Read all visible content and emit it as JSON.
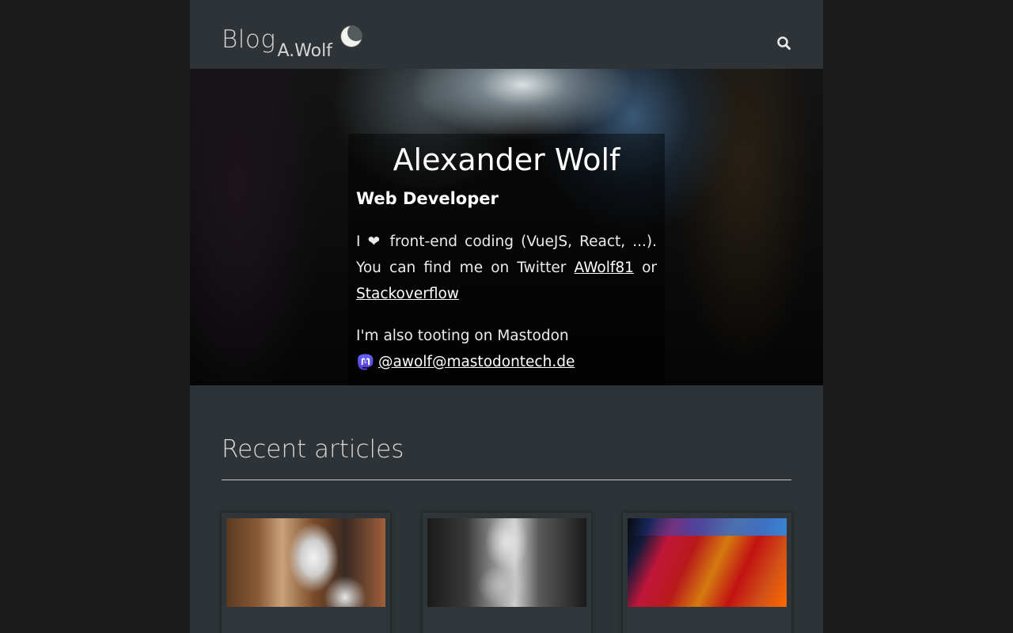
{
  "header": {
    "logo_blog": "Blog",
    "logo_name": "A.Wolf",
    "theme_toggle_icon": "moon-icon",
    "search_icon": "search-icon"
  },
  "hero": {
    "name": "Alexander Wolf",
    "role": "Web Developer",
    "bio_prefix": "I",
    "bio_heart": "❤",
    "bio_middle": " front-end coding (VueJS, React, ...). You can find me on Twitter ",
    "twitter_label": "AWolf81",
    "bio_or": " or ",
    "stackoverflow_label": "Stackoverflow",
    "mastodon_intro": "I'm also tooting on Mastodon",
    "mastodon_handle": "@awolf@mastodontech.de",
    "mastodon_icon": "mastodon-icon"
  },
  "recent": {
    "title": "Recent articles",
    "articles": [
      {
        "thumbnail": "article-thumbnail-1"
      },
      {
        "thumbnail": "article-thumbnail-2"
      },
      {
        "thumbnail": "article-thumbnail-3"
      }
    ]
  },
  "colors": {
    "page_background": "#2d3336",
    "outer_background": "#1a1a1a",
    "mastodon_purple": "#6364ff"
  }
}
